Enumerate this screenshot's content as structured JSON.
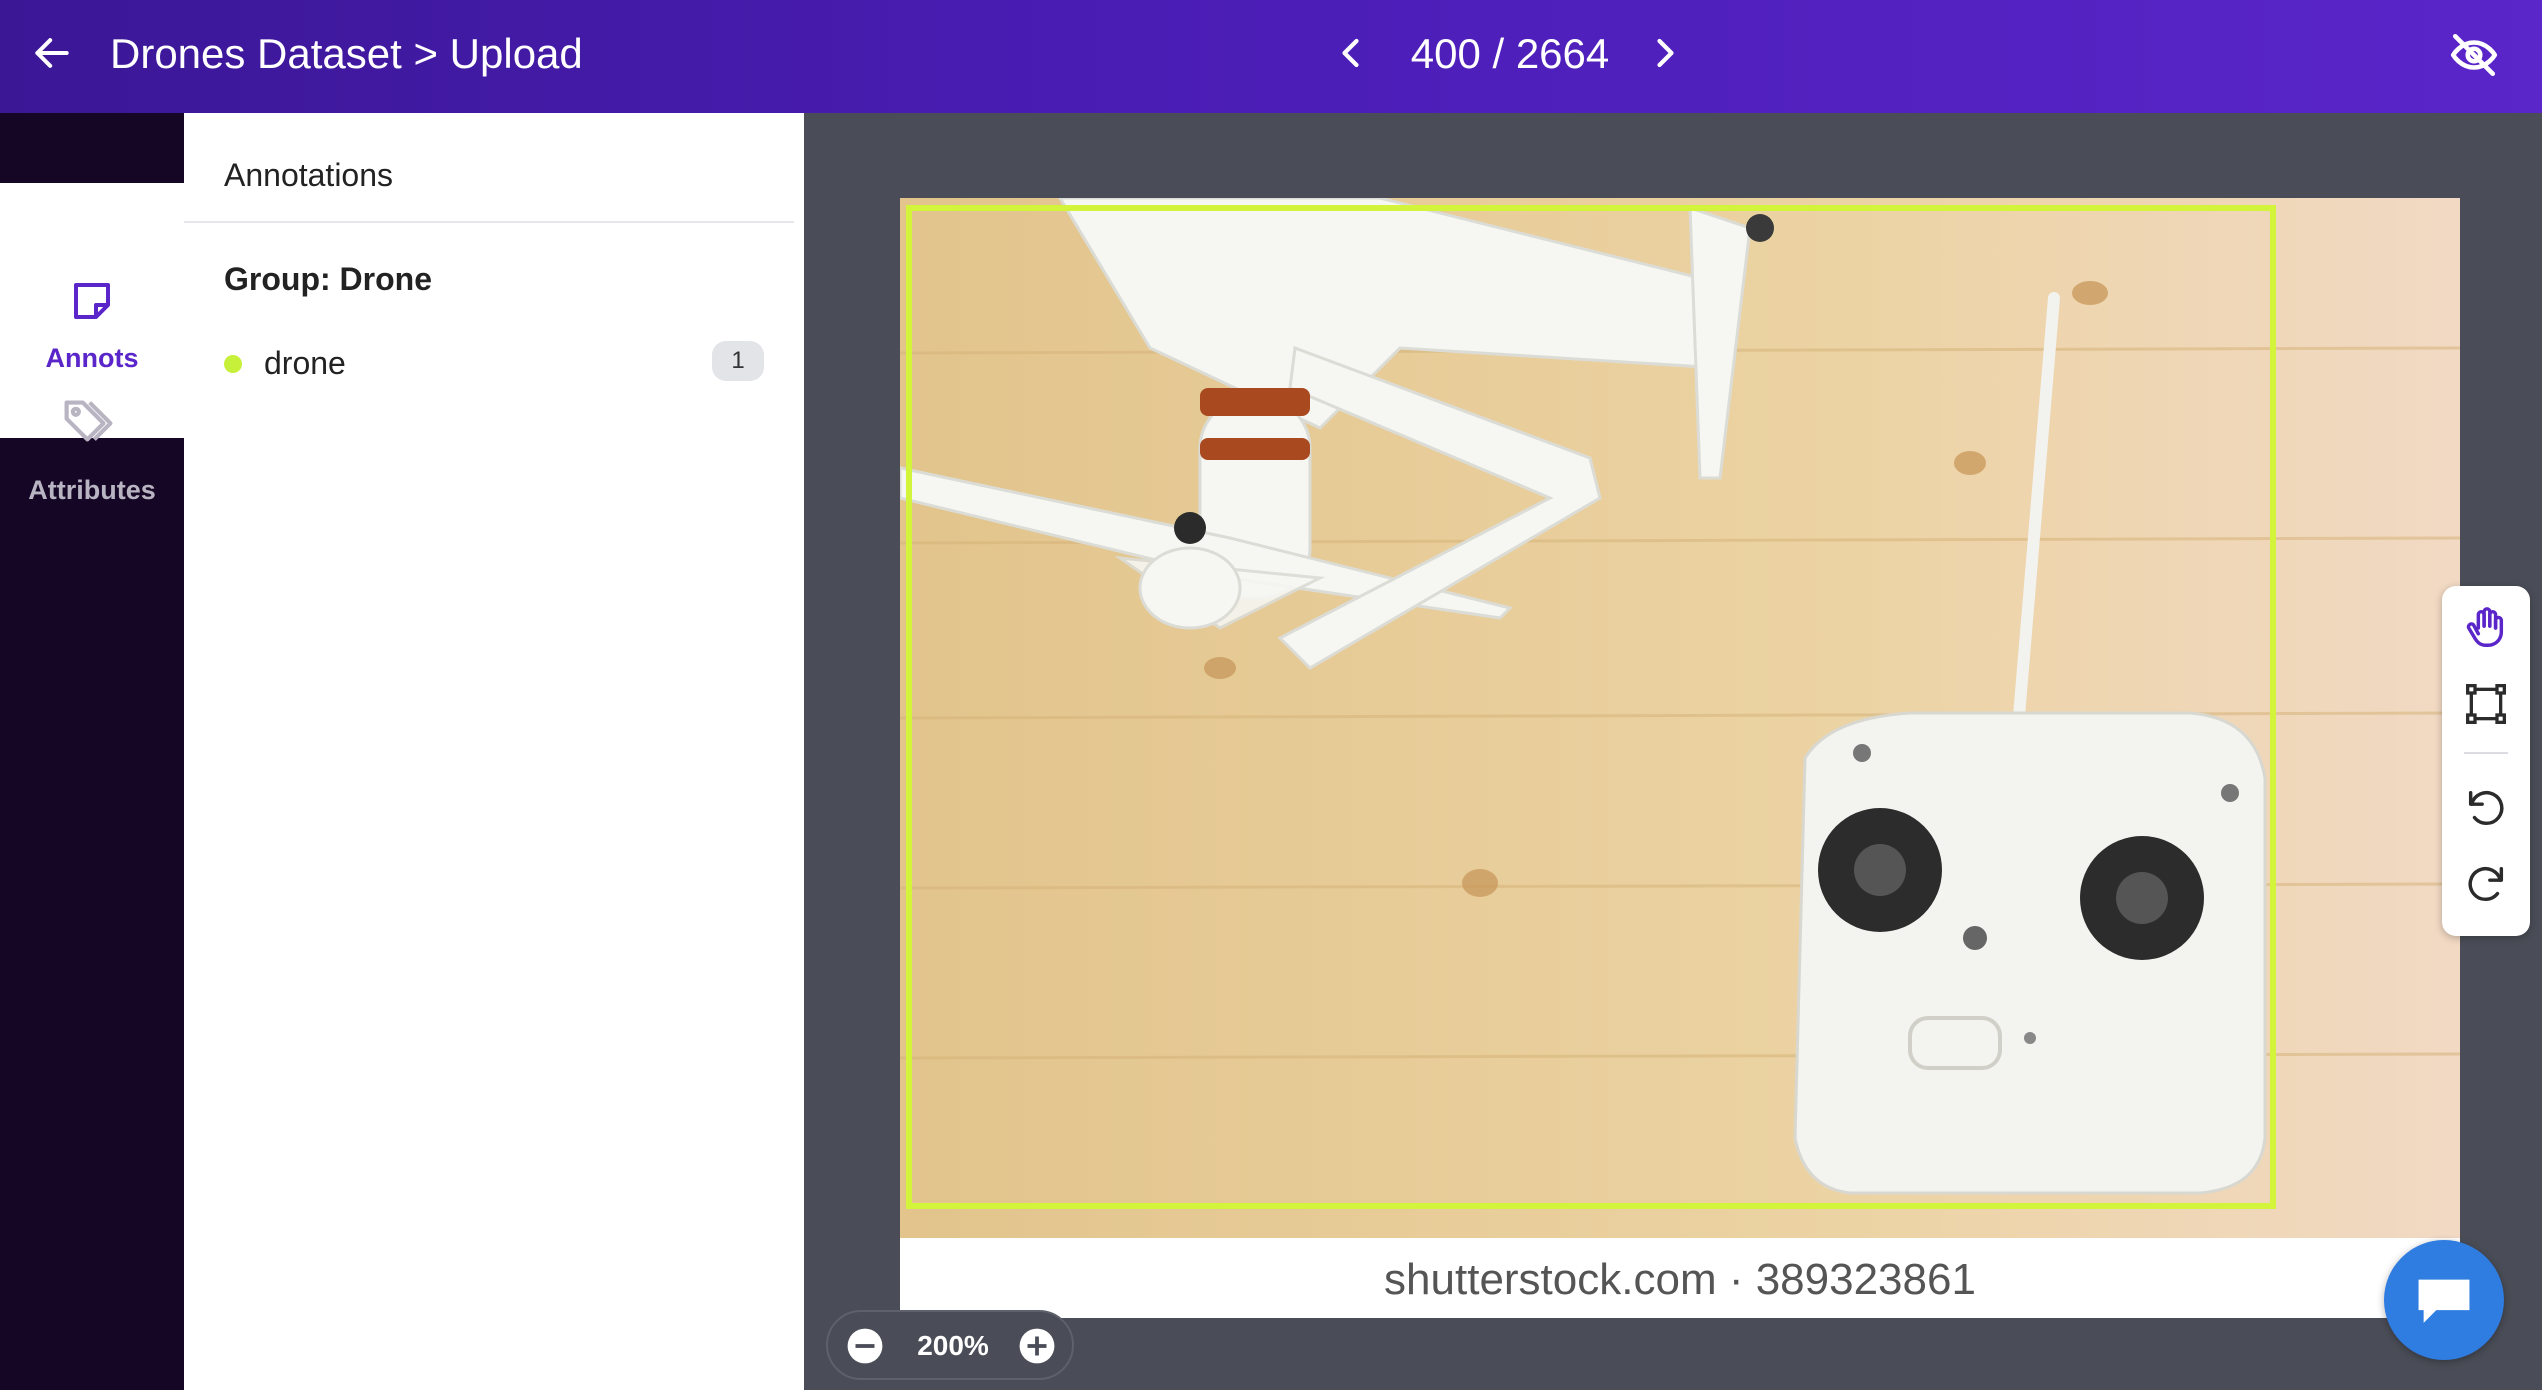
{
  "header": {
    "title": "Drones Dataset > Upload",
    "counter": "400 / 2664"
  },
  "rail": {
    "tabs": [
      {
        "label": "Annots",
        "icon": "note-icon",
        "active": true
      },
      {
        "label": "Attributes",
        "icon": "tags-icon",
        "active": false
      }
    ]
  },
  "panel": {
    "heading": "Annotations",
    "group": "Group: Drone",
    "items": [
      {
        "name": "drone",
        "count": "1",
        "color": "#c7f03a"
      }
    ]
  },
  "canvas": {
    "watermark": "shutterstock.com · 389323861",
    "bbox_color": "#d2f53c",
    "zoom": "200%",
    "tools": [
      "pan-hand-icon",
      "bounding-box-icon",
      "undo-icon",
      "redo-icon"
    ]
  },
  "colors": {
    "accent": "#5a25c9",
    "header": "#4a1db5",
    "rail": "#150626",
    "chat": "#2f7de1"
  }
}
